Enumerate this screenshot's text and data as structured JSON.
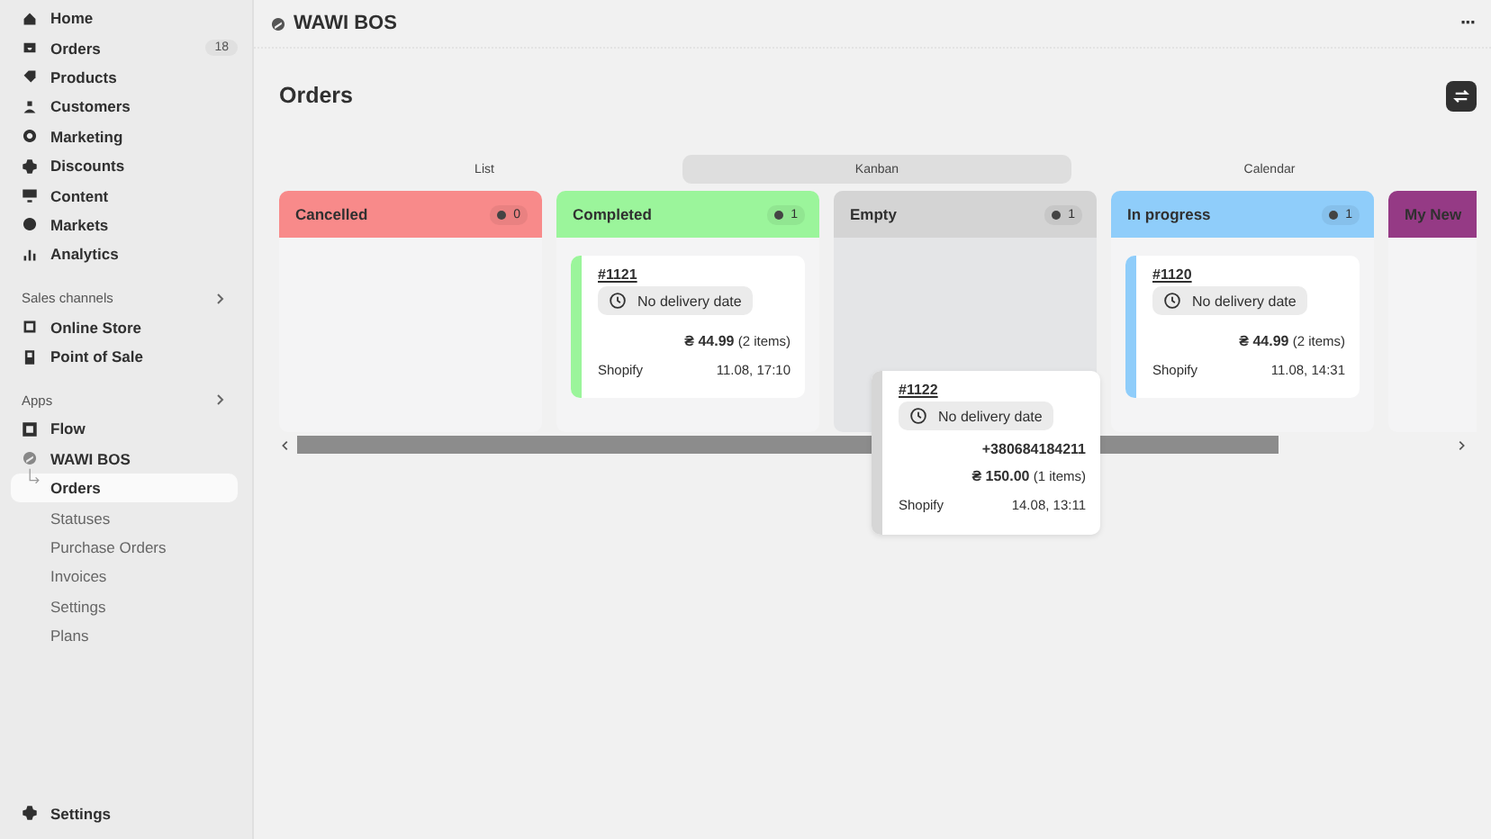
{
  "sidebar": {
    "items": [
      {
        "label": "Home"
      },
      {
        "label": "Orders",
        "count": "18"
      },
      {
        "label": "Products"
      },
      {
        "label": "Customers"
      },
      {
        "label": "Marketing"
      },
      {
        "label": "Discounts"
      },
      {
        "label": "Content"
      },
      {
        "label": "Markets"
      },
      {
        "label": "Analytics"
      }
    ],
    "sections": [
      {
        "title": "Sales channels",
        "items": [
          {
            "label": "Online Store"
          },
          {
            "label": "Point of Sale"
          }
        ]
      },
      {
        "title": "Apps",
        "items": [
          {
            "label": "Flow"
          },
          {
            "label": "WAWI BOS",
            "children": [
              {
                "label": "Orders",
                "selected": true
              },
              {
                "label": "Statuses",
                "selected": false
              },
              {
                "label": "Purchase Orders",
                "selected": false
              },
              {
                "label": "Invoices",
                "selected": false
              },
              {
                "label": "Settings",
                "selected": false
              },
              {
                "label": "Plans",
                "selected": false
              }
            ]
          }
        ]
      }
    ],
    "footer": {
      "label": "Settings"
    }
  },
  "app_bar": {
    "title": "WAWI BOS",
    "menu": "···"
  },
  "page": {
    "title": "Orders"
  },
  "tabs": [
    {
      "label": "List",
      "selected": false
    },
    {
      "label": "Kanban",
      "selected": true
    },
    {
      "label": "Calendar",
      "selected": false
    }
  ],
  "columns": [
    {
      "name": "Cancelled",
      "color": "#f88a8a",
      "count": "0",
      "drop_target": false
    },
    {
      "name": "Completed",
      "color": "#9bf59b",
      "count": "1",
      "drop_target": false,
      "cards": [
        {
          "number": "#1121",
          "delivery": "No delivery date",
          "price": "₴ 44.99",
          "items": "(2 items)",
          "source": "Shopify",
          "date": "11.08, 17:10"
        }
      ]
    },
    {
      "name": "Empty",
      "color": "#d4d4d4",
      "count": "1",
      "drop_target": true
    },
    {
      "name": "In progress",
      "color": "#8fcdfa",
      "count": "1",
      "drop_target": false,
      "cards": [
        {
          "number": "#1120",
          "delivery": "No delivery date",
          "price": "₴ 44.99",
          "items": "(2 items)",
          "source": "Shopify",
          "date": "11.08, 14:31"
        }
      ]
    },
    {
      "name": "My New",
      "color": "#953a85"
    }
  ],
  "dragged_card": {
    "number": "#1122",
    "delivery": "No delivery date",
    "phone": "+380684184211",
    "price": "₴ 150.00",
    "items": "(1 items)",
    "source": "Shopify",
    "date": "14.08, 13:11"
  }
}
